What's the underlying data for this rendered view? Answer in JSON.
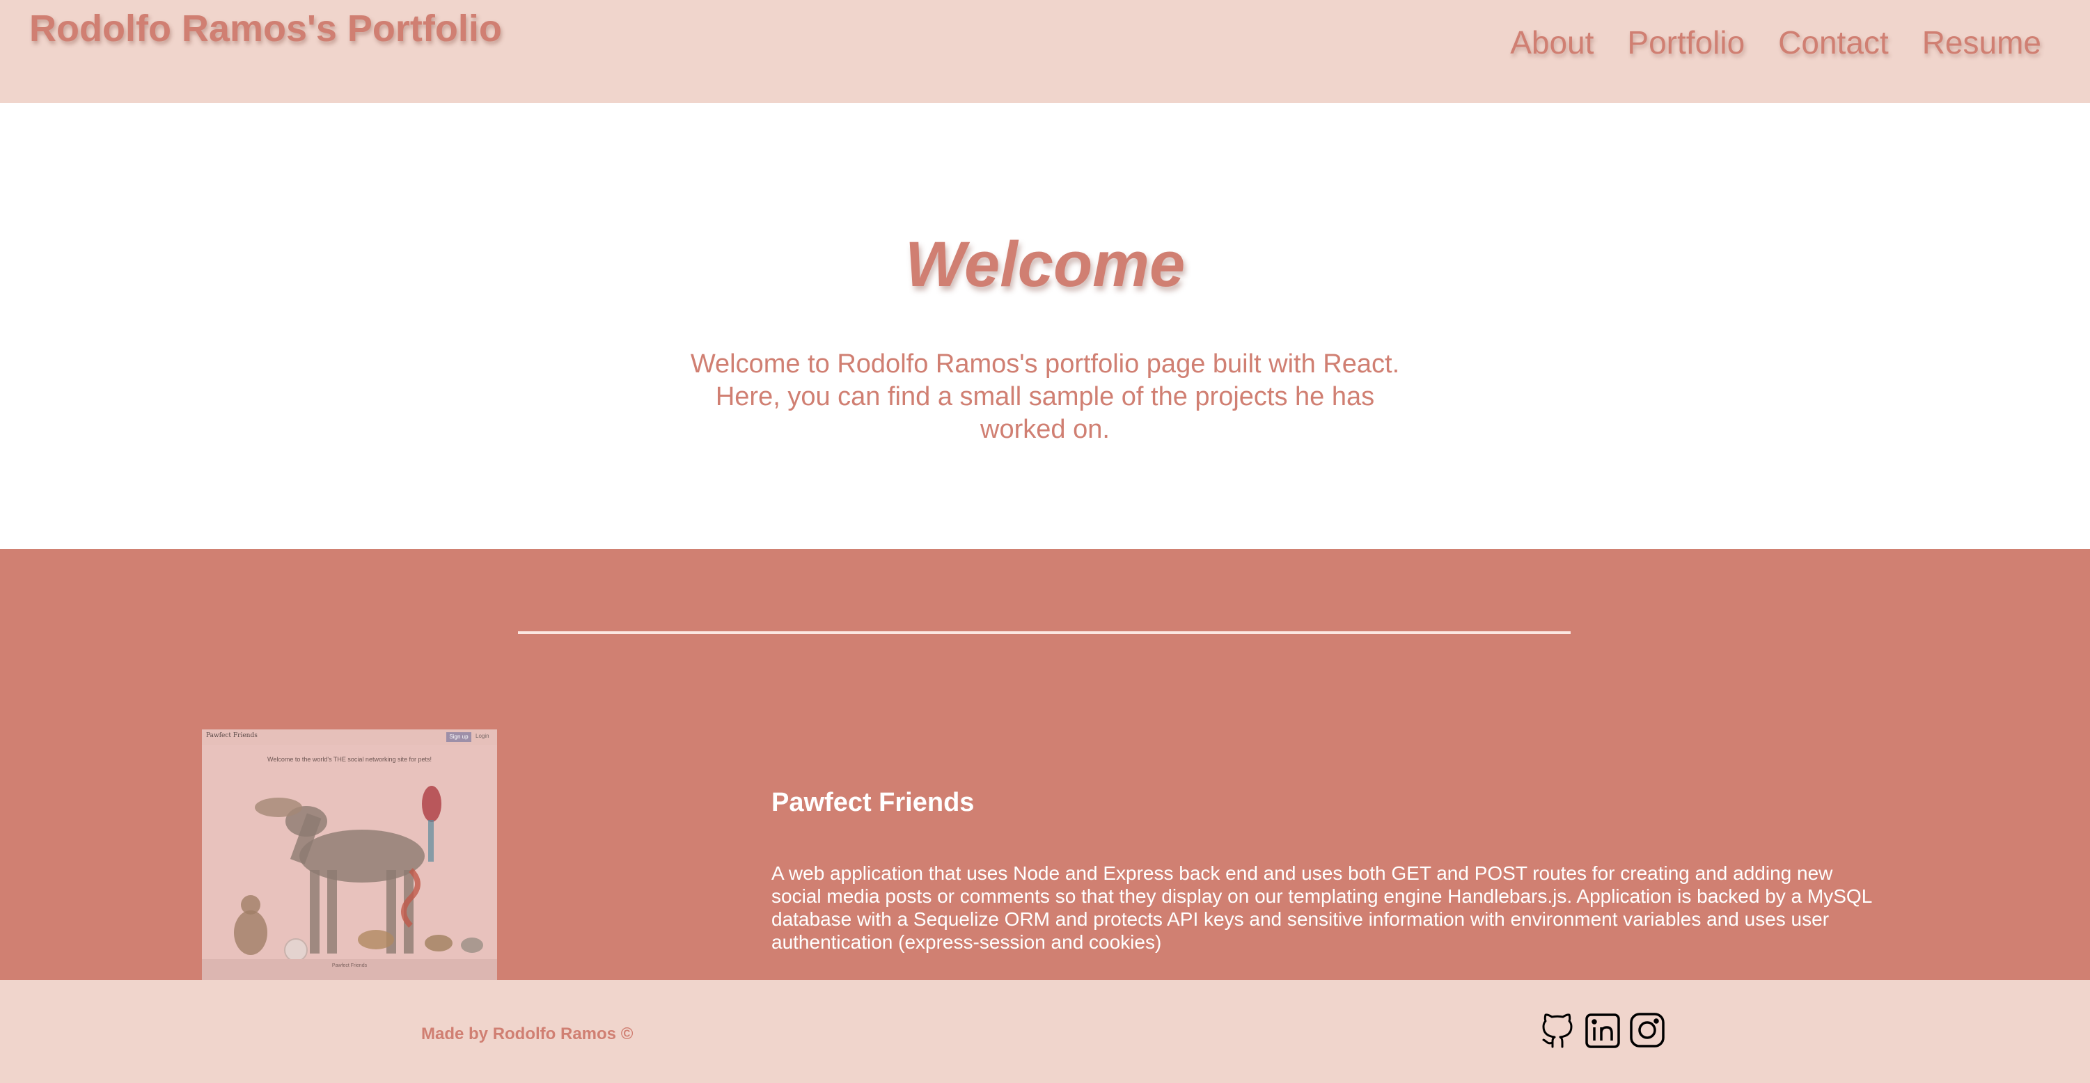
{
  "header": {
    "site_title": "Rodolfo Ramos's Portfolio",
    "nav": [
      {
        "label": "About"
      },
      {
        "label": "Portfolio"
      },
      {
        "label": "Contact"
      },
      {
        "label": "Resume"
      }
    ]
  },
  "hero": {
    "title": "Welcome",
    "text": "Welcome to Rodolfo Ramos's portfolio page built with React. Here, you can find a small sample of the projects he has worked on."
  },
  "portfolio": {
    "projects": [
      {
        "title": "Pawfect Friends",
        "description": "A web application that uses Node and Express back end and uses both GET and POST routes for creating and adding new social media posts or comments so that they display on our templating engine Handlebars.js. Application is backed by a MySQL database with a Sequelize ORM and protects API keys and sensitive information with environment variables and uses user authentication (express-session and cookies)",
        "screenshot": {
          "logo": "Pawfect Friends",
          "signup_label": "Sign up",
          "login_label": "Login",
          "caption": "Welcome to the world's THE social networking site for pets!",
          "footer": "Pawfect Friends"
        }
      }
    ]
  },
  "footer": {
    "credit": "Made by Rodolfo Ramos ©",
    "social_icons": [
      "github-icon",
      "linkedin-icon",
      "instagram-icon"
    ]
  },
  "colors": {
    "header_bg": "#f0d5cc",
    "accent": "#d07f72",
    "portfolio_bg": "#d08072",
    "white": "#ffffff"
  }
}
